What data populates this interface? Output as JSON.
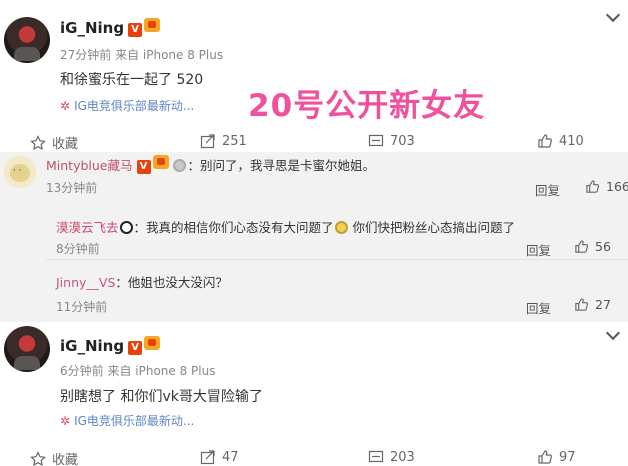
{
  "post1": {
    "username": "iG_Ning",
    "verified_badge": "V",
    "meta": "27分钟前 来自 iPhone 8 Plus",
    "content": "和徐蜜乐在一起了 520",
    "source": "IG电竞俱乐部最新动...",
    "source_icon": "flower",
    "actions": {
      "favorite": "收藏",
      "repost": "251",
      "comment": "703",
      "like": "410"
    }
  },
  "overlay_title": "20号公开新女友",
  "comments": {
    "top": {
      "nickname": "Mintyblue藏马",
      "badge": "V",
      "text": "：别问了，我寻思是卡蜜尔她姐。",
      "time": "13分钟前",
      "reply_label": "回复",
      "likes": "166"
    },
    "replies": [
      {
        "nickname": "漠漠云飞去",
        "text_a": "：我真的相信你们心态没有大问题了",
        "text_b": " 你们快把粉丝心态搞出问题了",
        "time": "8分钟前",
        "reply_label": "回复",
        "likes": "56"
      },
      {
        "nickname": "Jinny__VS",
        "text_a": "：他姐也没大没闪？",
        "time": "11分钟前",
        "reply_label": "回复",
        "likes": "27"
      }
    ]
  },
  "post2": {
    "username": "iG_Ning",
    "verified_badge": "V",
    "meta": "6分钟前 来自 iPhone 8 Plus",
    "content": "别瞎想了 和你们vk哥大冒险输了",
    "source": "IG电竞俱乐部最新动...",
    "source_icon": "flower",
    "actions": {
      "favorite": "收藏",
      "repost": "47",
      "comment": "203",
      "like": "97"
    }
  },
  "colors": {
    "accent_pink": "#f0509c",
    "link_blue": "#5e86c4",
    "verified_orange": "#e8410c",
    "comment_bg": "#f2f2f2"
  }
}
